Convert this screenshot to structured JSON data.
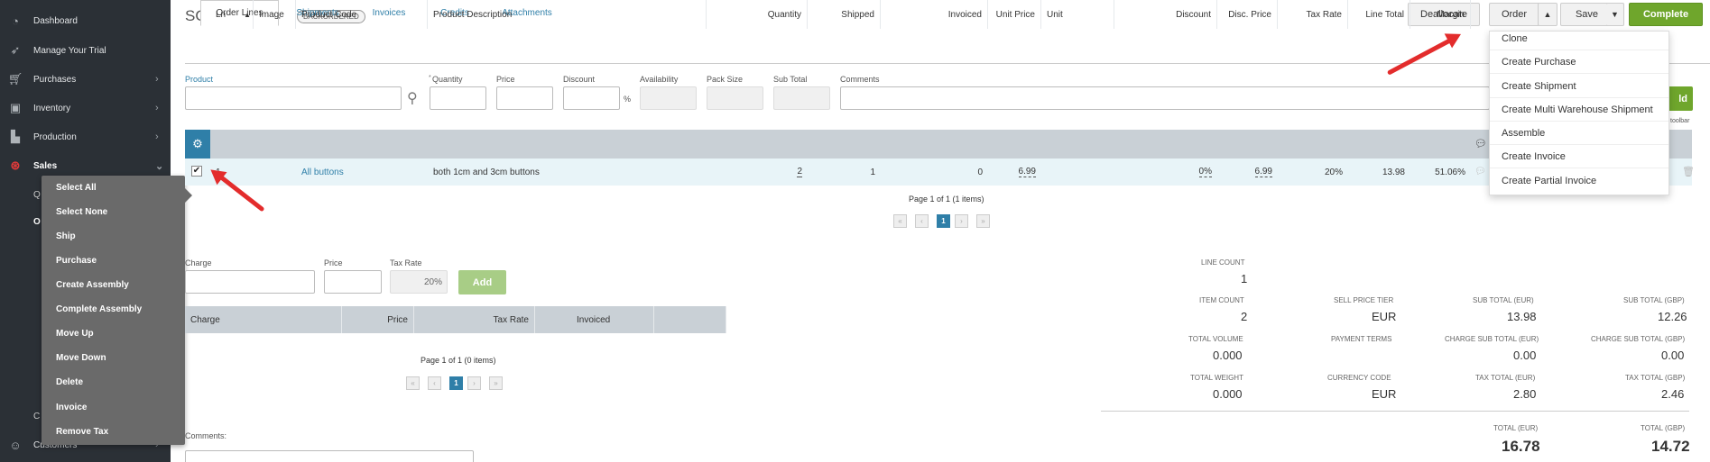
{
  "sidebar": {
    "items": [
      {
        "label": "Dashboard",
        "icon": "dashboard-icon"
      },
      {
        "label": "Manage Your Trial",
        "icon": "rocket-icon"
      },
      {
        "label": "Purchases",
        "icon": "cart-icon"
      },
      {
        "label": "Inventory",
        "icon": "box-icon"
      },
      {
        "label": "Production",
        "icon": "factory-icon"
      },
      {
        "label": "Sales",
        "icon": "dollar-icon"
      },
      {
        "label": "Customers",
        "icon": "customers-icon"
      }
    ],
    "partial_q": "Q",
    "partial_o": "O",
    "partial_c": "C"
  },
  "context_menu": {
    "items": [
      "Select All",
      "Select None",
      "Ship",
      "Purchase",
      "Create Assembly",
      "Complete Assembly",
      "Move Up",
      "Move Down",
      "Delete",
      "Invoice",
      "Remove Tax"
    ]
  },
  "header": {
    "title": "SO-00000174",
    "status_badge": "BACKORDERED",
    "buttons": {
      "deallocate": "Deallocate",
      "order": "Order",
      "save": "Save",
      "complete": "Complete"
    }
  },
  "order_dropdown": {
    "items": [
      "Clone",
      "Create Purchase",
      "Create Shipment",
      "Create Multi Warehouse Shipment",
      "Assemble",
      "Create Invoice",
      "Create Partial Invoice"
    ]
  },
  "tabs": [
    "Order Lines",
    "Shipments",
    "Invoices",
    "Credits",
    "Attachments"
  ],
  "add_line_form": {
    "product_label": "Product",
    "quantity_label": "Quantity",
    "quantity_required_mark": "*",
    "price_label": "Price",
    "discount_label": "Discount",
    "discount_unit": "%",
    "availability_label": "Availability",
    "pack_size_label": "Pack Size",
    "sub_total_label": "Sub Total",
    "comments_label": "Comments",
    "add_button_partial": "ld",
    "toolbar_partial": "toolbar"
  },
  "lines_table": {
    "columns": [
      "Ln",
      "Image",
      "Product Code",
      "Product Description",
      "Quantity",
      "Shipped",
      "Invoiced",
      "Unit Price",
      "Unit",
      "Discount",
      "Disc. Price",
      "Tax Rate",
      "Line Total",
      "Margin"
    ],
    "rows": [
      {
        "ln": "1",
        "product_code": "All buttons",
        "description": "both 1cm and 3cm buttons",
        "quantity": "2",
        "shipped": "1",
        "invoiced": "0",
        "unit_price": "6.99",
        "unit": "",
        "discount": "0%",
        "disc_price": "6.99",
        "tax_rate": "20%",
        "line_total": "13.98",
        "margin": "51.06%"
      }
    ],
    "pager_text": "Page 1 of 1 (1 items)",
    "current_page": "1"
  },
  "charges": {
    "charge_label": "Charge",
    "price_label": "Price",
    "tax_rate_label": "Tax Rate",
    "tax_rate_value": "20%",
    "add_button": "Add",
    "columns": [
      "Charge",
      "Price",
      "Tax Rate",
      "Invoiced"
    ],
    "pager_text": "Page 1 of 1 (0 items)",
    "current_page": "1"
  },
  "comments_label": "Comments:",
  "summary": {
    "line_count": {
      "label": "LINE COUNT",
      "value": "1"
    },
    "item_count": {
      "label": "ITEM COUNT",
      "value": "2"
    },
    "sell_price_tier": {
      "label": "SELL PRICE TIER",
      "value": "EUR"
    },
    "sub_total_eur": {
      "label": "SUB TOTAL (EUR)",
      "value": "13.98"
    },
    "sub_total_gbp": {
      "label": "SUB TOTAL (GBP)",
      "value": "12.26"
    },
    "total_volume": {
      "label": "TOTAL VOLUME",
      "value": "0.000"
    },
    "payment_terms": {
      "label": "PAYMENT TERMS",
      "value": ""
    },
    "charge_sub_total_eur": {
      "label": "CHARGE SUB TOTAL (EUR)",
      "value": "0.00"
    },
    "charge_sub_total_gbp": {
      "label": "CHARGE SUB TOTAL (GBP)",
      "value": "0.00"
    },
    "total_weight": {
      "label": "TOTAL WEIGHT",
      "value": "0.000"
    },
    "currency_code": {
      "label": "CURRENCY CODE",
      "value": "EUR"
    },
    "tax_total_eur": {
      "label": "TAX TOTAL (EUR)",
      "value": "2.80"
    },
    "tax_total_gbp": {
      "label": "TAX TOTAL (GBP)",
      "value": "2.46"
    },
    "total_eur": {
      "label": "TOTAL (EUR)",
      "value": "16.78"
    },
    "total_gbp": {
      "label": "TOTAL (GBP)",
      "value": "14.72"
    }
  },
  "colors": {
    "sidebar_bg": "#2b3036",
    "accent_blue": "#2f7fa8",
    "green": "#6fa62c",
    "annotation_red": "#e32c2c",
    "row_highlight": "#e8f4f8",
    "table_header": "#c9d0d6"
  }
}
